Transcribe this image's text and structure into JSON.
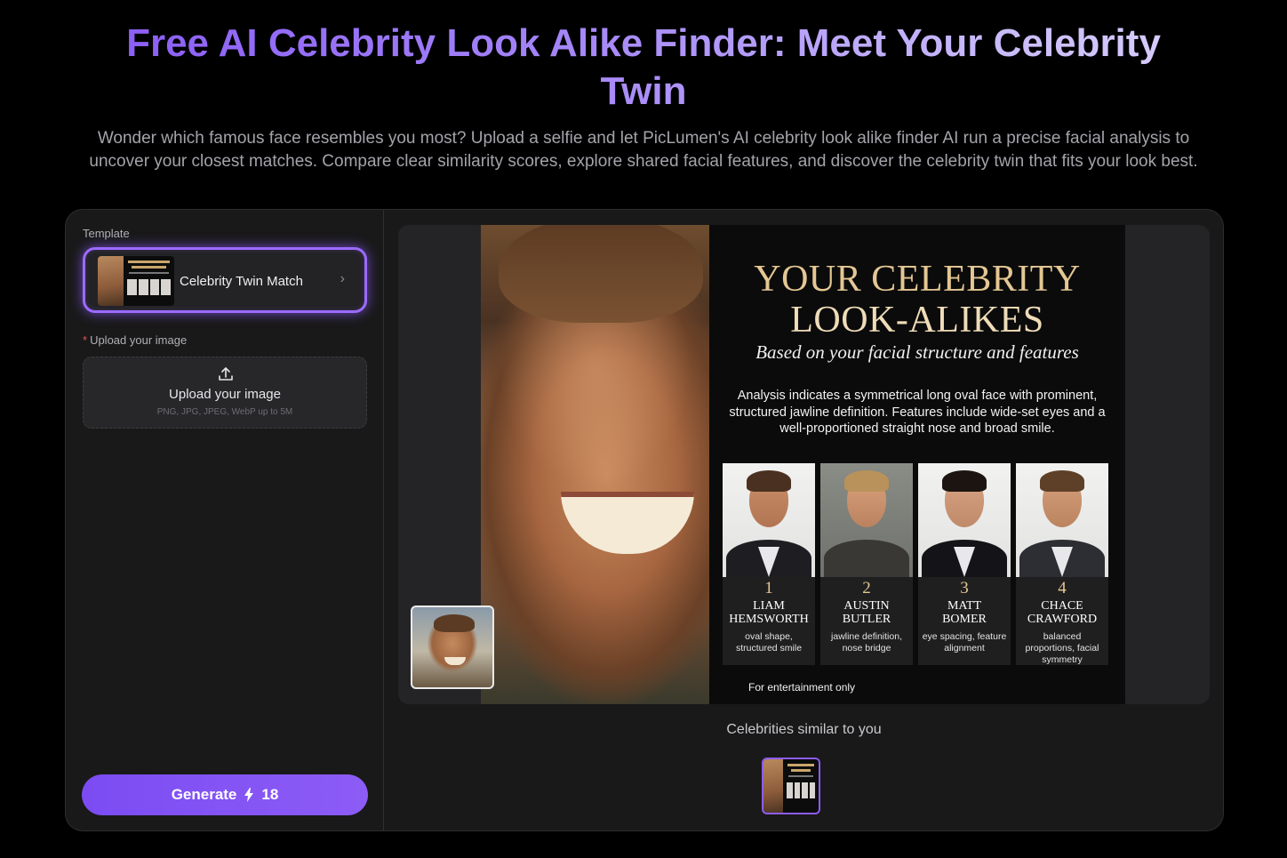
{
  "hero": {
    "title": "Free AI Celebrity Look Alike Finder: Meet Your Celebrity Twin",
    "subtitle": "Wonder which famous face resembles you most? Upload a selfie and let PicLumen's AI celebrity look alike finder AI run a precise facial analysis to uncover your closest matches. Compare clear similarity scores, explore shared facial features, and discover the celebrity twin that fits your look best."
  },
  "left_panel": {
    "template_label": "Template",
    "template_name": "Celebrity Twin Match",
    "template_chevron": "›",
    "upload_required_mark": "*",
    "upload_label": "Upload your image",
    "upload_box_title": "Upload your image",
    "upload_box_hint": "PNG, JPG, JPEG, WebP up to 5M",
    "upload_icon": "upload-icon",
    "generate_label": "Generate",
    "generate_cost": "18",
    "generate_icon": "lightning-bolt-icon"
  },
  "poster": {
    "title_line1": "YOUR CELEBRITY",
    "title_line2": "LOOK-ALIKES",
    "subtitle": "Based on your facial structure and features",
    "analysis": "Analysis indicates a symmetrical long oval face with prominent, structured jawline definition. Features include wide-set eyes and a well-proportioned straight nose and broad smile.",
    "matches": [
      {
        "rank": "1",
        "name_line1": "LIAM",
        "name_line2": "HEMSWORTH",
        "feature": "oval shape, structured smile"
      },
      {
        "rank": "2",
        "name_line1": "AUSTIN",
        "name_line2": "BUTLER",
        "feature": "jawline definition, nose bridge"
      },
      {
        "rank": "3",
        "name_line1": "MATT",
        "name_line2": "BOMER",
        "feature": "eye spacing, feature alignment"
      },
      {
        "rank": "4",
        "name_line1": "CHACE",
        "name_line2": "CRAWFORD",
        "feature": "balanced proportions, facial symmetry"
      }
    ],
    "disclaimer": "For entertainment only"
  },
  "results": {
    "similar_label": "Celebrities similar to you"
  },
  "colors": {
    "accent": "#8d5cf6",
    "poster_gold": "#e4c793",
    "panel_bg": "#191919"
  }
}
